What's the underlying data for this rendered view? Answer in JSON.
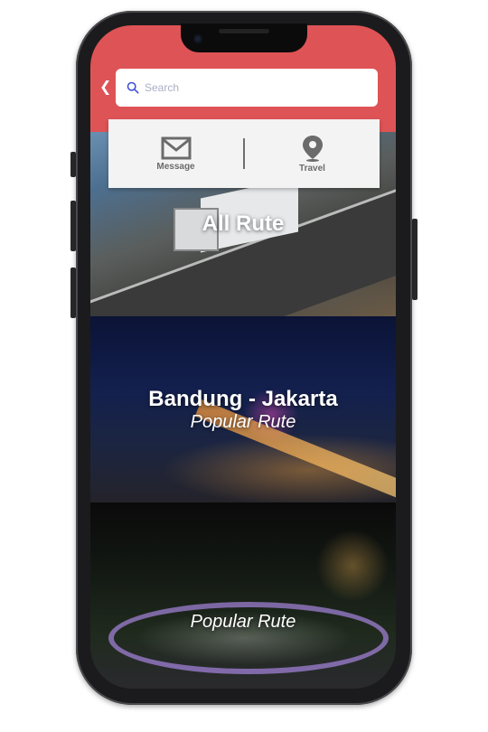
{
  "search": {
    "placeholder": "Search"
  },
  "menu": {
    "items": [
      {
        "label": "Message",
        "icon": "envelope-icon"
      },
      {
        "label": "Travel",
        "icon": "location-pin-icon"
      }
    ]
  },
  "cards": [
    {
      "title": "All Rute",
      "subtitle": ""
    },
    {
      "title": "Bandung - Jakarta",
      "subtitle": "Popular Rute"
    },
    {
      "title": "",
      "subtitle": "Popular Rute"
    }
  ],
  "colors": {
    "header": "#de5355",
    "menu_bg": "#f3f3f3",
    "icon_gray": "#6b6b6b"
  }
}
